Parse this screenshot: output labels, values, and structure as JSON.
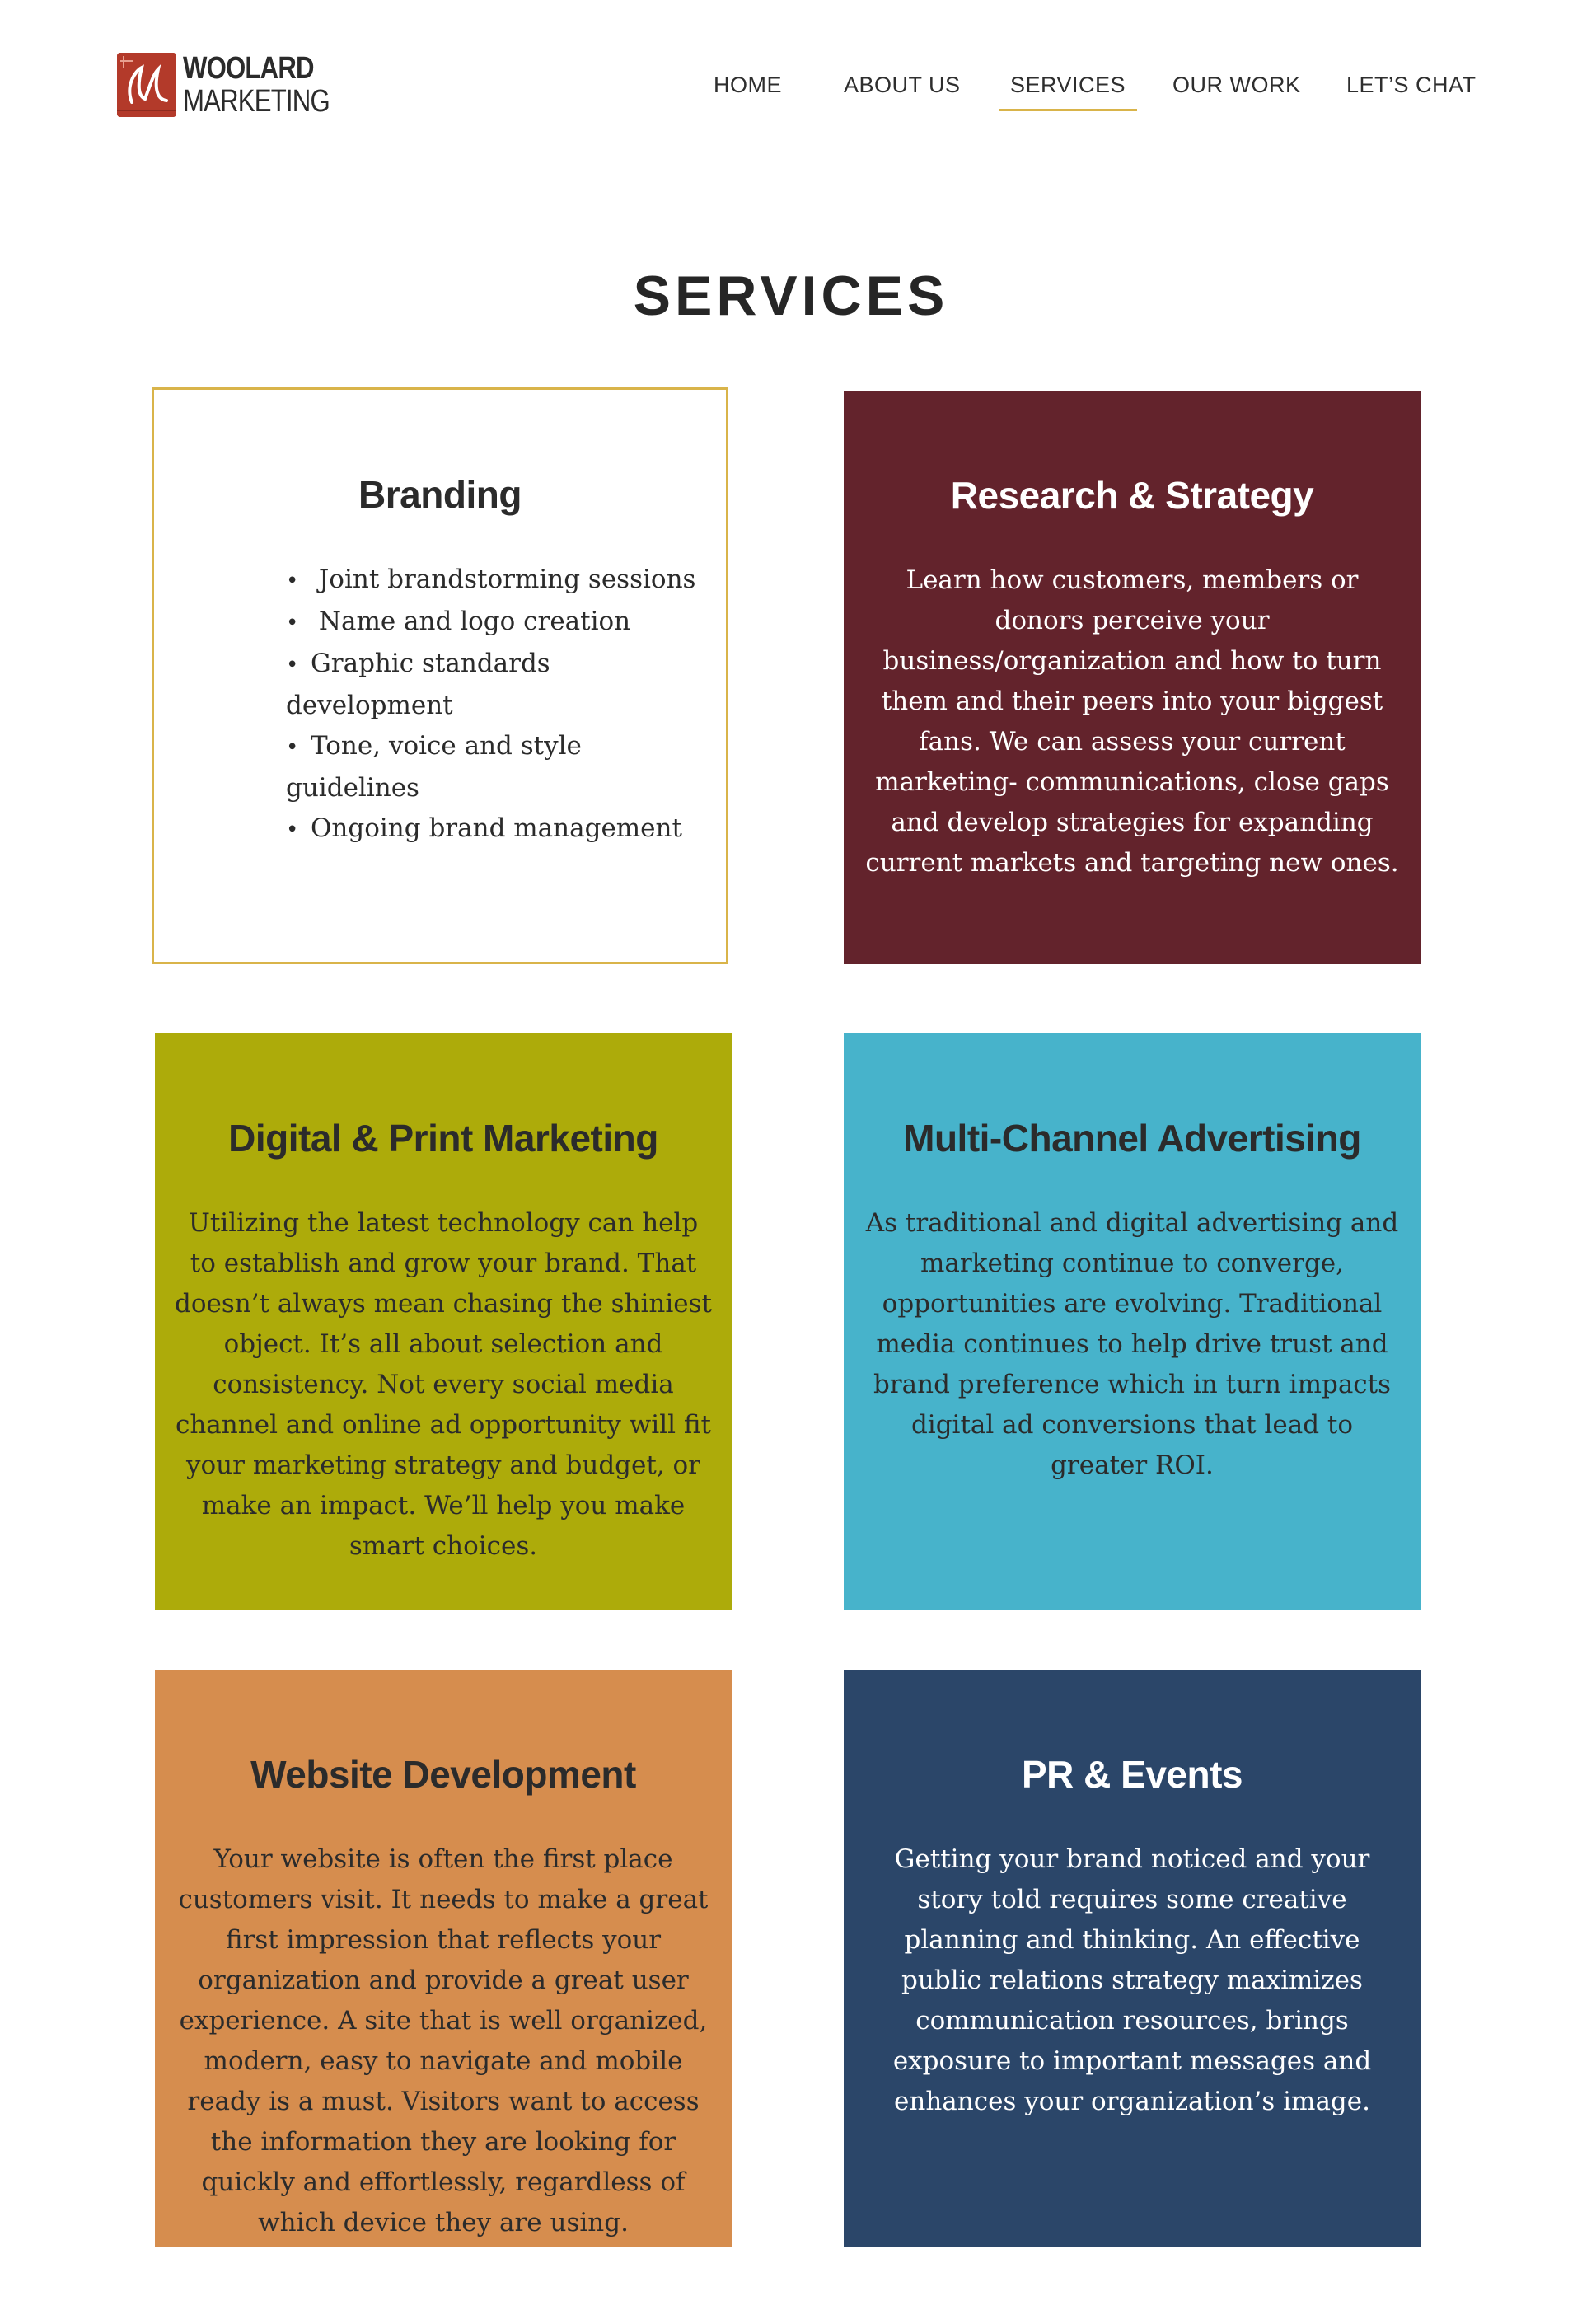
{
  "logo": {
    "line1": "WOOLARD",
    "line2": "MARKETING"
  },
  "nav": {
    "items": [
      {
        "label": "HOME"
      },
      {
        "label": "ABOUT US"
      },
      {
        "label": "SERVICES",
        "active": true
      },
      {
        "label": "OUR WORK"
      },
      {
        "label": "LET’S CHAT"
      }
    ]
  },
  "page": {
    "title": "SERVICES"
  },
  "services": {
    "branding": {
      "title": "Branding",
      "items": [
        " Joint brandstorming sessions",
        " Name and logo creation",
        "Graphic standards development",
        "Tone, voice and style guidelines",
        "Ongoing brand management"
      ]
    },
    "research": {
      "title": "Research & Strategy",
      "text": "Learn how customers, members or donors perceive your business/organization and how to turn them and their peers into your biggest fans. We can assess your current marketing- communications, close gaps and develop strategies for expanding current markets and targeting  new ones."
    },
    "digital": {
      "title": "Digital & Print Marketing",
      "text": "Utilizing the latest technology can help to establish and grow your brand. That doesn’t always mean chasing the shiniest object. It’s all about selection and consistency. Not every social media channel and online ad opportunity will fit your marketing strategy and budget, or make an impact. We’ll help you make smart choices."
    },
    "multichannel": {
      "title": "Multi-Channel Advertising",
      "text": "As traditional and digital advertising and marketing continue to converge, opportunities are evolving. Traditional media continues to help drive trust and brand preference which in turn impacts digital ad conversions that lead to greater ROI."
    },
    "website": {
      "title": "Website Development",
      "text": "Your website is often the first place customers visit. It needs to make a great first impression that reflects your organization and provide a great user experience.  A site that is well organized, modern, easy to navigate and mobile ready is a must. Visitors want to access the information they are looking for quickly and effortlessly, regardless of which device they are using."
    },
    "pr": {
      "title": "PR & Events",
      "text": "Getting your brand noticed and your story told requires some creative planning and thinking. An  effective public relations strategy maximizes communication resources, brings exposure to important messages and enhances your organization’s image."
    }
  },
  "colors": {
    "accent_gold": "#d9b44a",
    "research_bg": "#63232c",
    "digital_bg": "#adab0a",
    "multichannel_bg": "#47b3cb",
    "website_bg": "#d68d4e",
    "pr_bg": "#2b4669",
    "logo_red": "#b33a2a"
  }
}
